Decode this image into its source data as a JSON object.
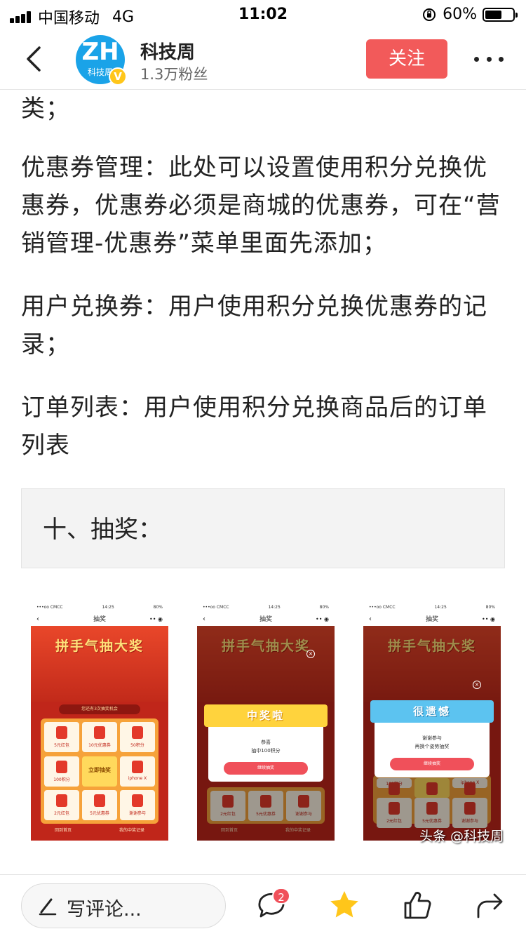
{
  "status_bar": {
    "carrier": "中国移动",
    "network": "4G",
    "time": "11:02",
    "battery": "60%",
    "battery_level": 0.6
  },
  "header": {
    "avatar_text": "ZH",
    "avatar_sub": "科技周",
    "verified_mark": "V",
    "account_name": "科技周",
    "fans": "1.3万粉丝",
    "follow_label": "关注"
  },
  "article": {
    "paragraphs": [
      "类；",
      "优惠券管理：此处可以设置使用积分兑换优惠券，优惠券必须是商城的优惠券，可在“营销管理-优惠券”菜单里面先添加；",
      "用户兑换券：用户使用积分兑换优惠券的记录；",
      "订单列表：用户使用积分兑换商品后的订单列表"
    ],
    "section_heading": "十、抽奖："
  },
  "image": {
    "phones": [
      {
        "status_left": "•••oo CMCC",
        "status_time": "14:25",
        "status_right": "80%",
        "nav_title": "抽奖",
        "banner": "拼手气抽大奖",
        "chance": "您还有3次抽奖机会",
        "cells": [
          "5元红包",
          "10元优惠券",
          "50积分",
          "100积分",
          "立即抽奖",
          "iphone X",
          "2元红包",
          "5元优惠券",
          "谢谢参与"
        ],
        "footer_left": "回到首页",
        "footer_right": "我的中奖记录"
      },
      {
        "status_left": "•••oo CMCC",
        "status_time": "14:25",
        "status_right": "80%",
        "nav_title": "抽奖",
        "banner": "拼手气抽大奖",
        "dialog_title": "中奖啦",
        "dialog_line1": "恭喜",
        "dialog_line2": "抽中100积分",
        "dialog_button": "继续抽奖",
        "cells": [
          "2元红包",
          "5元优惠券",
          "谢谢参与"
        ],
        "footer_left": "回到首页",
        "footer_right": "我的中奖记录"
      },
      {
        "status_left": "•••oo CMCC",
        "status_time": "14:25",
        "status_right": "80%",
        "nav_title": "抽奖",
        "banner": "拼手气抽大奖",
        "dialog_title": "很遗憾",
        "dialog_line1": "谢谢参与",
        "dialog_line2": "再换个姿势抽奖",
        "dialog_button": "继续抽奖",
        "cells": [
          "100积分",
          "iphone X",
          "2元红包",
          "5元优惠券",
          "谢谢参与"
        ]
      }
    ],
    "watermark": "头条 @科技周"
  },
  "bottom_bar": {
    "comment_placeholder": "写评论...",
    "comment_count": "2"
  },
  "colors": {
    "follow": "#f25a5a",
    "avatar": "#1aa3e8",
    "verified": "#ffc61a",
    "star": "#ffc61a",
    "badge": "#f0505a"
  },
  "icons": [
    "back-arrow-icon",
    "more-icon",
    "pen-icon",
    "comment-icon",
    "star-icon",
    "like-icon",
    "share-icon"
  ]
}
